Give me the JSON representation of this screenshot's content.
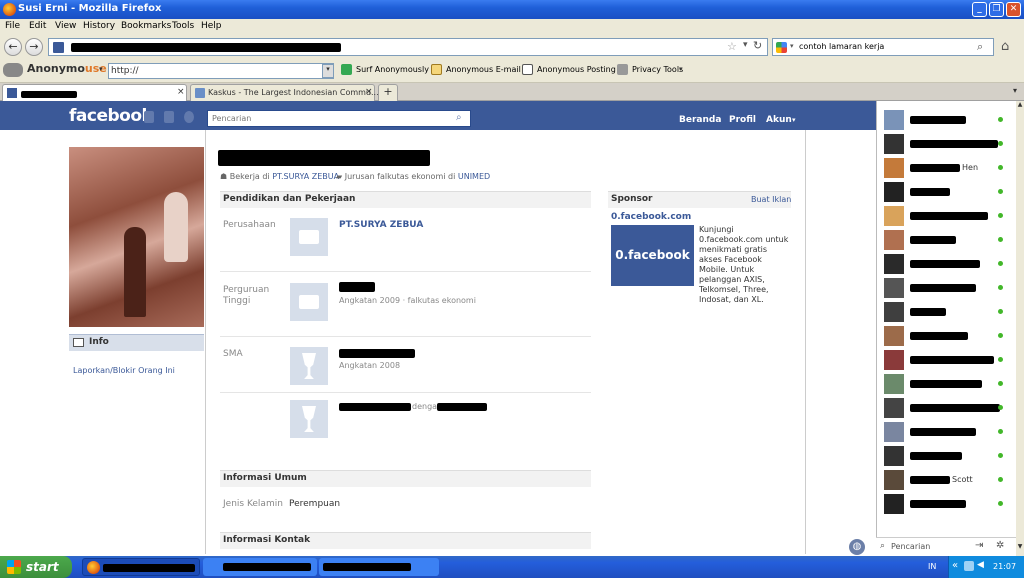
{
  "window": {
    "title": "Susi Erni - Mozilla Firefox"
  },
  "menu": [
    "File",
    "Edit",
    "View",
    "History",
    "Bookmarks",
    "Tools",
    "Help"
  ],
  "nav": {
    "search_value": "contoh lamaran kerja"
  },
  "anon_toolbar": {
    "logo_a": "Anonymo",
    "logo_b": "use",
    "url_value": "http://",
    "surf": "Surf Anonymously",
    "email": "Anonymous E-mail",
    "posting": "Anonymous Posting",
    "privacy": "Privacy Tools"
  },
  "tabs": [
    {
      "label": ""
    },
    {
      "label": "Kaskus - The Largest Indonesian Commu..."
    }
  ],
  "fb": {
    "logo": "facebook",
    "search_placeholder": "Pencarian",
    "nav": [
      "Beranda",
      "Profil",
      "Akun"
    ],
    "work_line": "Bekerja di",
    "work_link": "PT.SURYA ZEBUA",
    "study_line": "Jurusan falkutas ekonomi di",
    "study_link": "UNIMED",
    "info_tab": "Info",
    "report": "Laporkan/Blokir Orang Ini"
  },
  "sections": {
    "education_title": "Pendidikan dan Pekerjaan",
    "company_label": "Perusahaan",
    "company_value": "PT.SURYA ZEBUA",
    "college_label": "Perguruan Tinggi",
    "college_sub": "Angkatan 2009 · falkutas ekonomi",
    "sma_label": "SMA",
    "sma_sub": "Angkatan 2008",
    "sma2_with": "dengan",
    "general_title": "Informasi Umum",
    "gender_label": "Jenis Kelamin",
    "gender_value": "Perempuan",
    "contact_title": "Informasi Kontak"
  },
  "sponsor": {
    "title": "Sponsor",
    "create_ad": "Buat Iklan",
    "ad_title": "0.facebook.com",
    "ad_image_text": "0.facebook",
    "ad_body": "Kunjungi 0.facebook.com untuk menikmati gratis akses Facebook Mobile. Untuk pelanggan AXIS, Telkomsel, Three, Indosat, dan XL."
  },
  "chat": {
    "names": [
      "",
      "",
      "Hen",
      "",
      "",
      "",
      "",
      "",
      "",
      "",
      "",
      "",
      "",
      "",
      "",
      "Scott",
      ""
    ],
    "search_placeholder": "Pencarian"
  },
  "taskbar": {
    "start": "start",
    "lang": "IN",
    "clock": "21:07"
  }
}
